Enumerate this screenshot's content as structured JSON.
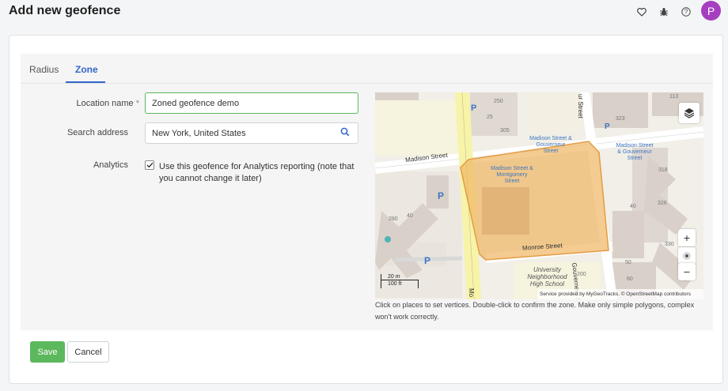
{
  "header": {
    "title": "Add new geofence",
    "icons": [
      "heart-icon",
      "bug-icon",
      "help-icon"
    ],
    "avatar_initial": "P"
  },
  "tabs": [
    {
      "label": "Radius",
      "active": false
    },
    {
      "label": "Zone",
      "active": true
    }
  ],
  "form": {
    "location_name_label": "Location name",
    "required_mark": "*",
    "location_name_value": "Zoned geofence demo",
    "search_address_label": "Search address",
    "search_address_value": "New York, United States",
    "analytics_label": "Analytics",
    "analytics_checked": true,
    "analytics_text": "Use this geofence for Analytics reporting (note that you cannot change it later)"
  },
  "map": {
    "streets": [
      "Madison Street",
      "Monroe Street",
      "Gouverneur Street",
      "Mo"
    ],
    "pois": [
      "Madison Street & Gouverneur Street",
      "Madison Street & Montgomery Street",
      "Madison Street & Gouverneur Street",
      "University Neighborhood High School"
    ],
    "house_numbers": [
      "250",
      "25",
      "305",
      "323",
      "113",
      "318",
      "326",
      "280",
      "40",
      "40",
      "330",
      "50",
      "60",
      "200"
    ],
    "street_fragments": [
      "ur Street"
    ],
    "parking_label": "P",
    "scale_m": "20 m",
    "scale_ft": "100 ft",
    "attribution": "Service provided by  MyGeoTracks. © OpenStreetMap contributors",
    "zoom_in": "+",
    "zoom_out": "−",
    "hint": "Click on places to set vertices. Double-click to confirm the zone. Make only simple polygons, complex won't work correctly."
  },
  "actions": {
    "save_label": "Save",
    "cancel_label": "Cancel"
  },
  "colors": {
    "accent": "#3466c8",
    "save": "#5cb85c",
    "avatar": "#a63fbf",
    "zone_fill": "#f0b766"
  }
}
